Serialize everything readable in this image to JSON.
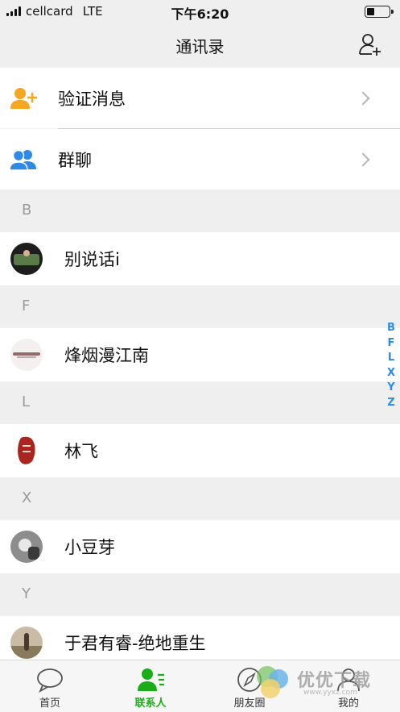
{
  "status_bar": {
    "carrier": "cellcard",
    "network": "LTE",
    "time": "下午6:20"
  },
  "nav": {
    "title": "通讯录",
    "add_icon": "add-contact-icon"
  },
  "menu": [
    {
      "label": "验证消息",
      "icon": "verify-user-icon",
      "color": "#f5a623"
    },
    {
      "label": "群聊",
      "icon": "group-chat-icon",
      "color": "#2f8ae6"
    }
  ],
  "sections": [
    {
      "letter": "B",
      "contacts": [
        {
          "name": "别说话i"
        }
      ]
    },
    {
      "letter": "F",
      "contacts": [
        {
          "name": "烽烟漫江南"
        }
      ]
    },
    {
      "letter": "L",
      "contacts": [
        {
          "name": "林飞"
        }
      ]
    },
    {
      "letter": "X",
      "contacts": [
        {
          "name": "小豆芽"
        }
      ]
    },
    {
      "letter": "Y",
      "contacts": [
        {
          "name": "于君有睿-绝地重生"
        }
      ]
    }
  ],
  "index_letters": [
    "B",
    "F",
    "L",
    "X",
    "Y",
    "Z"
  ],
  "tabs": [
    {
      "label": "首页",
      "icon": "chat-bubble-icon",
      "active": false
    },
    {
      "label": "联系人",
      "icon": "contacts-icon",
      "active": true
    },
    {
      "label": "朋友圈",
      "icon": "compass-icon",
      "active": false
    },
    {
      "label": "我的",
      "icon": "profile-icon",
      "active": false
    }
  ],
  "watermark": {
    "text": "优优下载",
    "sub": "www.yyxz.com"
  },
  "colors": {
    "accent_green": "#1aad19",
    "index_blue": "#2a8be8"
  }
}
